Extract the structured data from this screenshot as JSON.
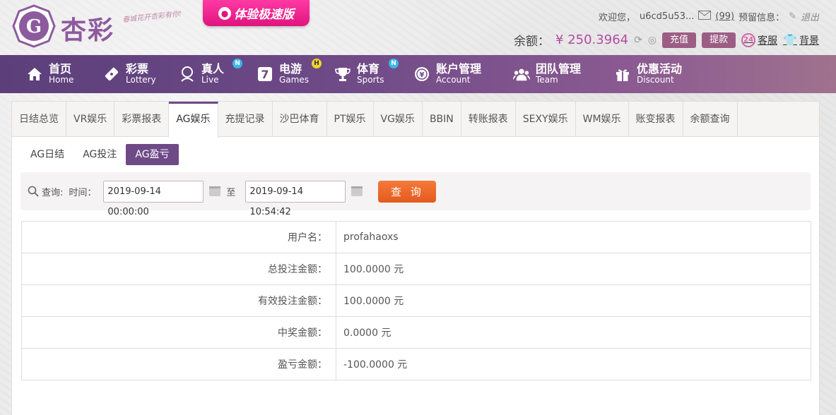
{
  "brand": {
    "name": "杏彩",
    "slogan": "春城花开杏彩有你!",
    "promo": "体验极速版"
  },
  "user": {
    "welcome": "欢迎您，",
    "username": "u6cd5u53...",
    "message_count": "(99)",
    "reserve_label": "预留信息：",
    "logout": "退出"
  },
  "balance": {
    "label": "余额：",
    "value": "¥ 250.3964",
    "recharge": "充值",
    "withdraw": "提款",
    "service": "客服",
    "service_icon_text": "24",
    "background": "背景"
  },
  "nav": [
    {
      "cn": "首页",
      "en": "Home",
      "icon": "home-icon"
    },
    {
      "cn": "彩票",
      "en": "Lottery",
      "icon": "ticket-icon"
    },
    {
      "cn": "真人",
      "en": "Live",
      "icon": "woman-icon",
      "badge": "N"
    },
    {
      "cn": "电游",
      "en": "Games",
      "icon": "seven-icon",
      "badge": "H"
    },
    {
      "cn": "体育",
      "en": "Sports",
      "icon": "trophy-icon",
      "badge": "N"
    },
    {
      "cn": "账户管理",
      "en": "Account",
      "icon": "yen-coin-icon"
    },
    {
      "cn": "团队管理",
      "en": "Team",
      "icon": "team-icon"
    },
    {
      "cn": "优惠活动",
      "en": "Discount",
      "icon": "gift-icon"
    }
  ],
  "tabs": [
    "日结总览",
    "VR娱乐",
    "彩票报表",
    "AG娱乐",
    "充提记录",
    "沙巴体育",
    "PT娱乐",
    "VG娱乐",
    "BBIN",
    "转账报表",
    "SEXY娱乐",
    "WM娱乐",
    "账变报表",
    "余额查询"
  ],
  "active_tab": "AG娱乐",
  "subtabs": [
    "AG日结",
    "AG投注",
    "AG盈亏"
  ],
  "active_subtab": "AG盈亏",
  "search": {
    "label": "查询:",
    "time_label": "时间：",
    "start": "2019-09-14 00:00:00",
    "to": "至",
    "end": "2019-09-14 10:54:42",
    "button": "查 询"
  },
  "results": [
    {
      "label": "用户名：",
      "value": "profahaoxs"
    },
    {
      "label": "总投注金额：",
      "value": "100.0000 元"
    },
    {
      "label": "有效投注金额：",
      "value": "100.0000 元"
    },
    {
      "label": "中奖金额：",
      "value": "0.0000 元"
    },
    {
      "label": "盈亏金额：",
      "value": "-100.0000 元"
    }
  ],
  "colors": {
    "accent": "#6e4a87",
    "balance": "#b04c9f",
    "query_button": "#e45b1e",
    "promo": "#e0147f"
  }
}
